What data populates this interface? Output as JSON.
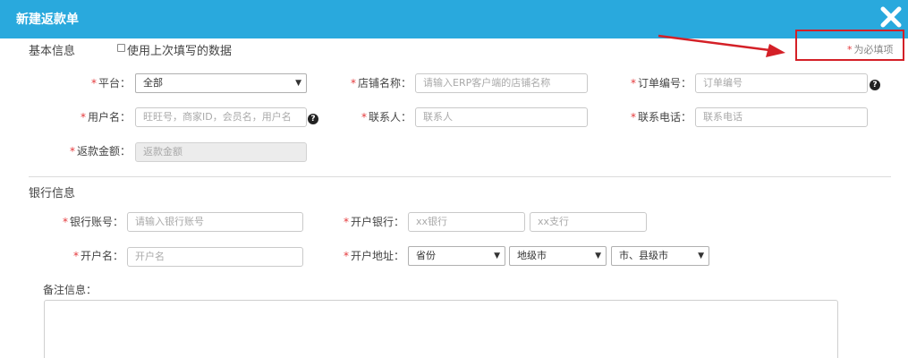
{
  "dialog": {
    "title": "新建返款单",
    "close_icon": "close-icon"
  },
  "basic": {
    "section_title": "基本信息",
    "use_last_label": "使用上次填写的数据",
    "required_note": "为必填项",
    "required_mark": "*"
  },
  "fields": {
    "platform": {
      "label": "平台：",
      "value": "全部"
    },
    "store": {
      "label": "店铺名称：",
      "placeholder": "请输入ERP客户端的店铺名称"
    },
    "order": {
      "label": "订单编号：",
      "placeholder": "订单编号"
    },
    "username": {
      "label": "用户名：",
      "placeholder": "旺旺号，商家ID，会员名，用户名"
    },
    "contact": {
      "label": "联系人：",
      "placeholder": "联系人"
    },
    "phone": {
      "label": "联系电话：",
      "placeholder": "联系电话"
    },
    "amount": {
      "label": "返款金额：",
      "placeholder": "返款金额"
    }
  },
  "bank": {
    "section_title": "银行信息",
    "account": {
      "label": "银行账号：",
      "placeholder": "请输入银行账号"
    },
    "bank_name": {
      "label": "开户银行：",
      "placeholder_bank": "xx银行",
      "placeholder_branch": "xx支行"
    },
    "holder": {
      "label": "开户名：",
      "placeholder": "开户名"
    },
    "address": {
      "label": "开户地址：",
      "province": "省份",
      "city": "地级市",
      "county": "市、县级市"
    }
  },
  "notes": {
    "label": "备注信息："
  },
  "annotation": {
    "arrow_color": "#d42027"
  }
}
